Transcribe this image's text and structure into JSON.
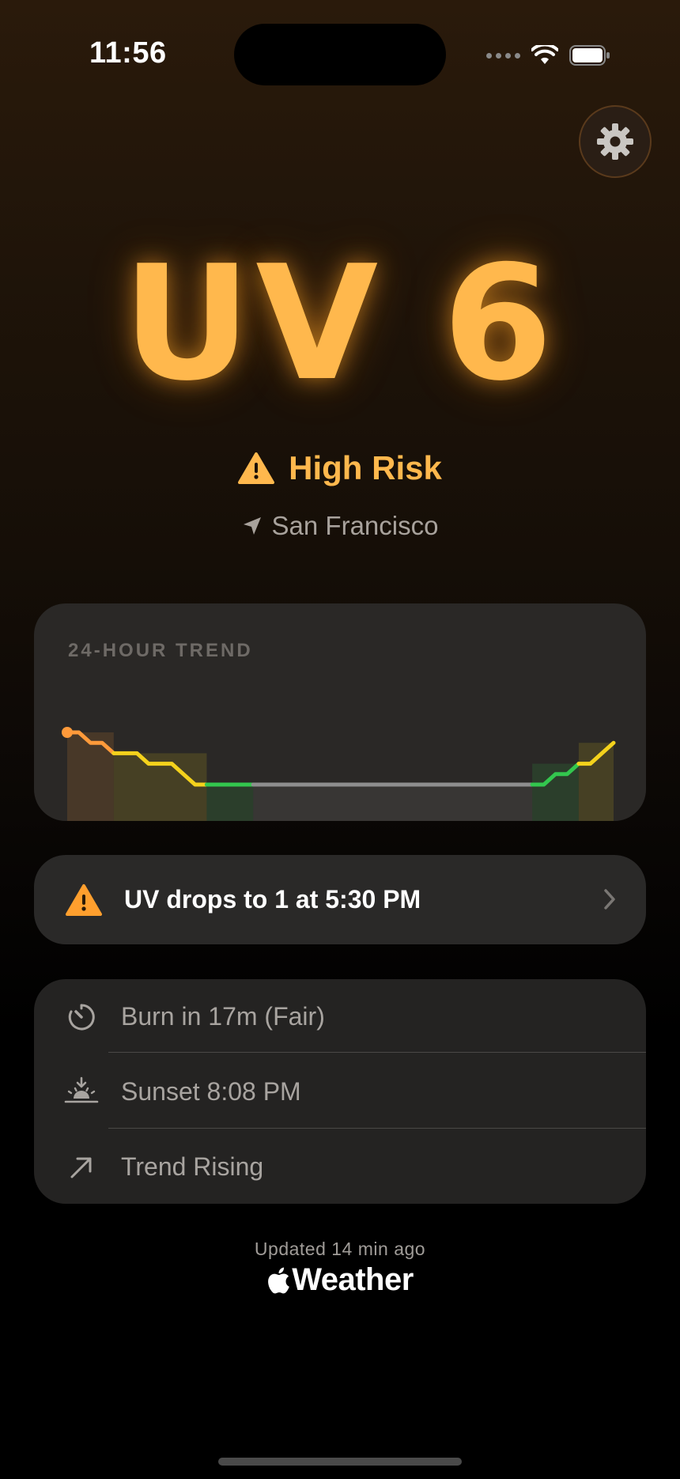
{
  "status_bar": {
    "time": "11:56"
  },
  "settings": {
    "icon": "gear-icon"
  },
  "uv": {
    "value_text": "UV 6",
    "value": 6,
    "color": "#ffb84d"
  },
  "risk": {
    "label": "High Risk",
    "icon": "warning-triangle-icon"
  },
  "location": {
    "name": "San Francisco",
    "icon": "location-arrow-icon"
  },
  "trend": {
    "title": "24-HOUR TREND",
    "chart_data": {
      "type": "area",
      "title": "24-HOUR TREND",
      "values": [
        6,
        6,
        5,
        5,
        4,
        4,
        4,
        3,
        3,
        3,
        2,
        1,
        1,
        1,
        1,
        1,
        1,
        1,
        1,
        1,
        1,
        1,
        1,
        1,
        1,
        1,
        1,
        1,
        1,
        1,
        1,
        1,
        1,
        1,
        1,
        1,
        1,
        1,
        1,
        1,
        1,
        1,
        2,
        2,
        3,
        3,
        4,
        5
      ],
      "color_bands": [
        {
          "from": 0,
          "to": 4,
          "color": "#ff9a3a"
        },
        {
          "from": 4,
          "to": 12,
          "color": "#f4d21c"
        },
        {
          "from": 12,
          "to": 16,
          "color": "#33c74e"
        },
        {
          "from": 16,
          "to": 40,
          "color": "#8e8e8e"
        },
        {
          "from": 40,
          "to": 44,
          "color": "#33c74e"
        },
        {
          "from": 44,
          "to": 47,
          "color": "#f4d21c"
        }
      ]
    }
  },
  "alert": {
    "text": "UV drops to 1 at 5:30 PM",
    "icon": "warning-triangle-icon",
    "accent": "#ff9f2e"
  },
  "info": [
    {
      "icon": "timer-icon",
      "text": "Burn in 17m (Fair)"
    },
    {
      "icon": "sunset-icon",
      "text": "Sunset 8:08 PM"
    },
    {
      "icon": "arrow-up-right-icon",
      "text": "Trend Rising"
    }
  ],
  "footer": {
    "updated": "Updated 14 min ago",
    "brand": "Weather"
  }
}
